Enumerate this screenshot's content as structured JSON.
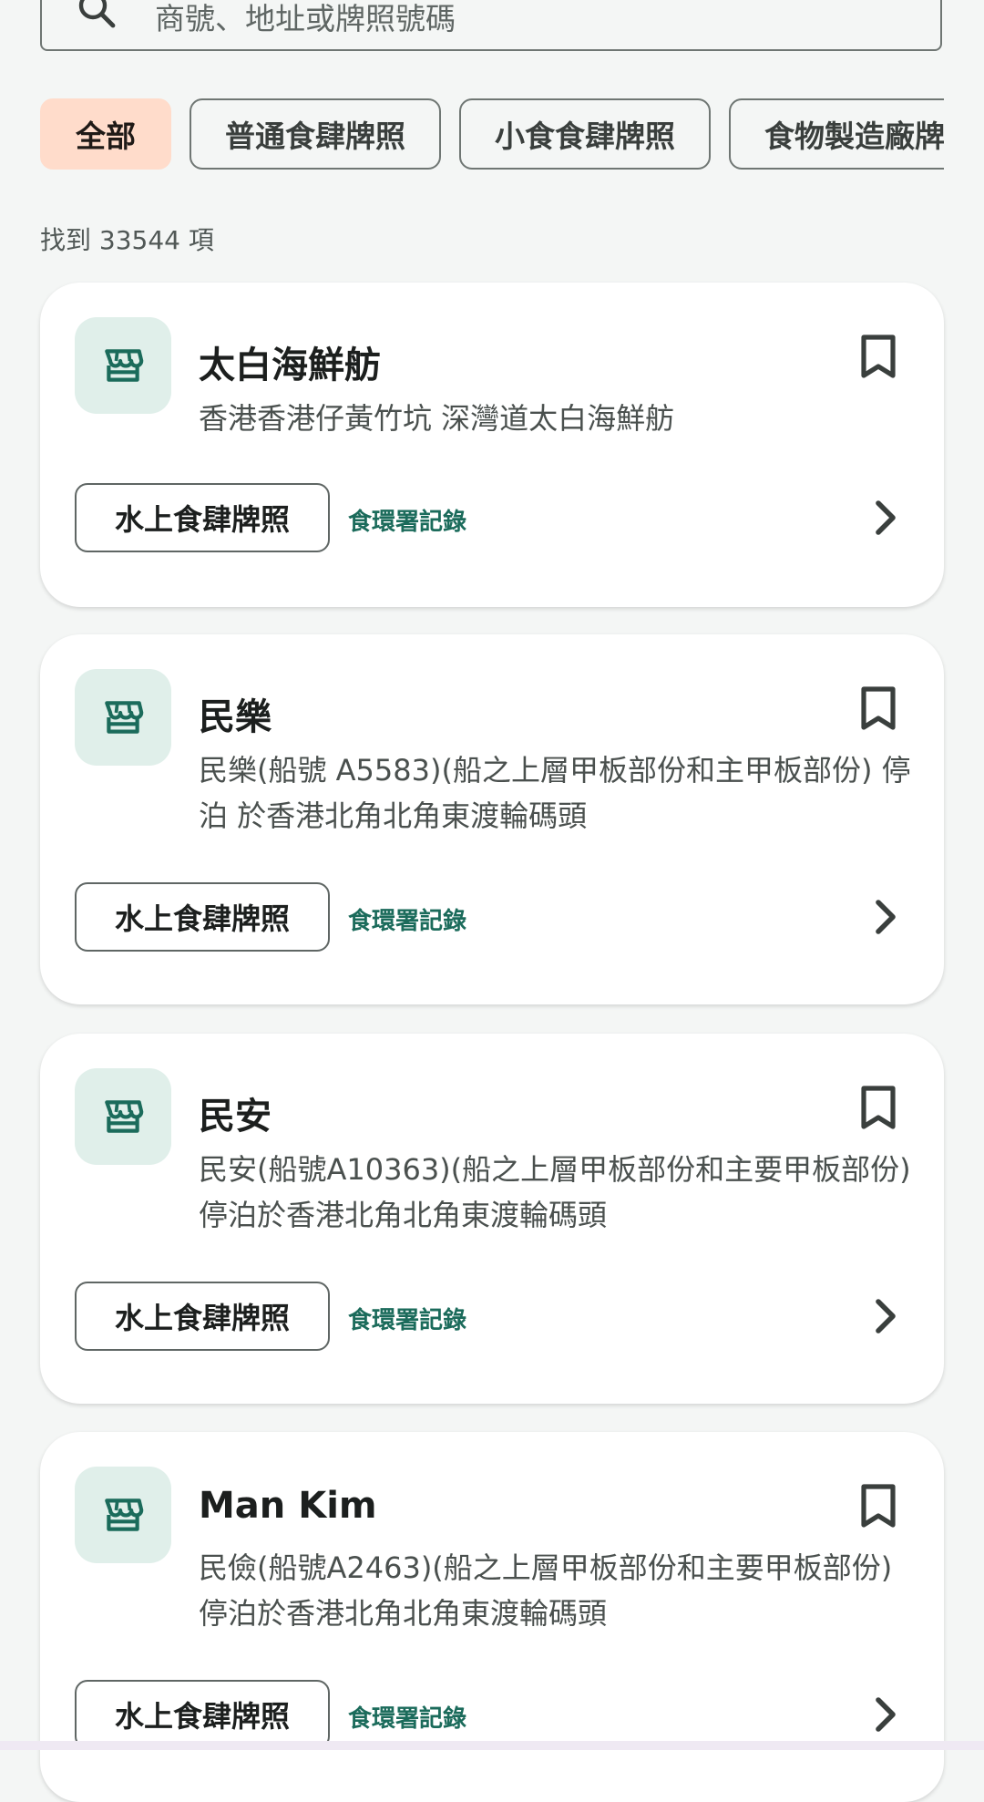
{
  "search": {
    "placeholder": "商號、地址或牌照號碼",
    "icon": "search-icon"
  },
  "filters": {
    "chips": [
      {
        "label": "全部",
        "selected": true
      },
      {
        "label": "普通食肆牌照",
        "selected": false
      },
      {
        "label": "小食食肆牌照",
        "selected": false
      },
      {
        "label": "食物製造廠牌照",
        "selected": false
      }
    ]
  },
  "results": {
    "count_text": "找到 33544 項"
  },
  "cards": [
    {
      "title": "太白海鮮舫",
      "address": "香港香港仔黃竹坑 深灣道太白海鮮舫",
      "license": "水上食肆牌照",
      "source": "食環署記錄",
      "icon": "store-icon"
    },
    {
      "title": "民樂",
      "address": "民樂(船號 A5583)(船之上層甲板部份和主甲板部份) 停泊 於香港北角北角東渡輪碼頭",
      "license": "水上食肆牌照",
      "source": "食環署記錄",
      "icon": "store-icon"
    },
    {
      "title": "民安",
      "address": "民安(船號A10363)(船之上層甲板部份和主要甲板部份) 停泊於香港北角北角東渡輪碼頭",
      "license": "水上食肆牌照",
      "source": "食環署記錄",
      "icon": "store-icon"
    },
    {
      "title": "Man Kim",
      "address": "民儉(船號A2463)(船之上層甲板部份和主要甲板部份) 停泊於香港北角北角東渡輪碼頭",
      "license": "水上食肆牌照",
      "source": "食環署記錄",
      "icon": "store-icon"
    }
  ],
  "colors": {
    "background": "#f4f6f5",
    "selected_chip": "#ffdccb",
    "accent": "#1b6b5b",
    "icon_bg": "#e0efea"
  }
}
